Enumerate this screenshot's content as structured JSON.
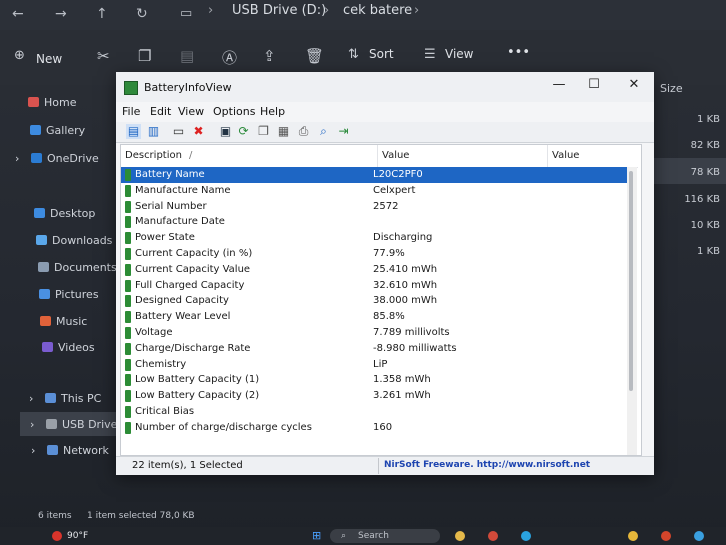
{
  "explorer": {
    "breadcrumb": [
      "USB Drive (D:)",
      "cek batere"
    ],
    "toolbar": {
      "new_label": "New",
      "sort_label": "Sort",
      "view_label": "View",
      "more_label": "•••"
    },
    "sidebar": [
      {
        "label": "Home",
        "icon": "home-icon",
        "color": "#d9534f"
      },
      {
        "label": "Gallery",
        "icon": "gallery-icon",
        "color": "#3d8be0"
      },
      {
        "label": "OneDrive",
        "icon": "cloud-icon",
        "color": "#2b7cd3"
      },
      {
        "label": "Desktop",
        "icon": "desktop-icon",
        "color": "#3d8be0"
      },
      {
        "label": "Downloads",
        "icon": "download-icon",
        "color": "#5aa7ea"
      },
      {
        "label": "Documents",
        "icon": "documents-icon",
        "color": "#8a9bb0"
      },
      {
        "label": "Pictures",
        "icon": "pictures-icon",
        "color": "#4a90e2"
      },
      {
        "label": "Music",
        "icon": "music-icon",
        "color": "#e0623a"
      },
      {
        "label": "Videos",
        "icon": "videos-icon",
        "color": "#7a5cd0"
      },
      {
        "label": "This PC",
        "icon": "pc-icon",
        "color": "#5b8fd6"
      },
      {
        "label": "USB Drive (D:)",
        "icon": "usb-drive-icon",
        "color": "#9aa0a8"
      },
      {
        "label": "Network",
        "icon": "network-icon",
        "color": "#5b8fd6"
      }
    ],
    "size_header": "Size",
    "sizes": [
      "1 KB",
      "82 KB",
      "78 KB",
      "116 KB",
      "10 KB",
      "1 KB"
    ],
    "status": {
      "items": "6 items",
      "selected": "1 item selected  78,0 KB"
    },
    "taskbar": {
      "weather": "90°F",
      "search": "Search"
    }
  },
  "app": {
    "title": "BatteryInfoView",
    "menu": [
      "File",
      "Edit",
      "View",
      "Options",
      "Help"
    ],
    "columns": {
      "description": "Description",
      "sort_indicator": "/",
      "value": "Value",
      "value2": "Value"
    },
    "rows": [
      {
        "description": "Battery Name",
        "value": "L20C2PF0",
        "selected": true
      },
      {
        "description": "Manufacture Name",
        "value": "Celxpert"
      },
      {
        "description": "Serial Number",
        "value": "2572"
      },
      {
        "description": "Manufacture Date",
        "value": ""
      },
      {
        "description": "Power State",
        "value": "Discharging"
      },
      {
        "description": "Current Capacity (in %)",
        "value": "77.9%"
      },
      {
        "description": "Current Capacity Value",
        "value": "25.410 mWh"
      },
      {
        "description": "Full Charged Capacity",
        "value": "32.610 mWh"
      },
      {
        "description": "Designed Capacity",
        "value": "38.000 mWh"
      },
      {
        "description": "Battery Wear Level",
        "value": "85.8%"
      },
      {
        "description": "Voltage",
        "value": "7.789 millivolts"
      },
      {
        "description": "Charge/Discharge Rate",
        "value": "-8.980 milliwatts"
      },
      {
        "description": "Chemistry",
        "value": "LiP"
      },
      {
        "description": "Low Battery Capacity (1)",
        "value": "1.358 mWh"
      },
      {
        "description": "Low Battery Capacity (2)",
        "value": "3.261 mWh"
      },
      {
        "description": "Critical Bias",
        "value": ""
      },
      {
        "description": "Number of charge/discharge cycles",
        "value": "160"
      }
    ],
    "status_left": "22 item(s), 1 Selected",
    "status_right": "NirSoft Freeware.  http://www.nirsoft.net",
    "colors": {
      "selection": "#1e66c4",
      "battery_icon": "#2c8c36",
      "link": "#1e45b0"
    }
  }
}
